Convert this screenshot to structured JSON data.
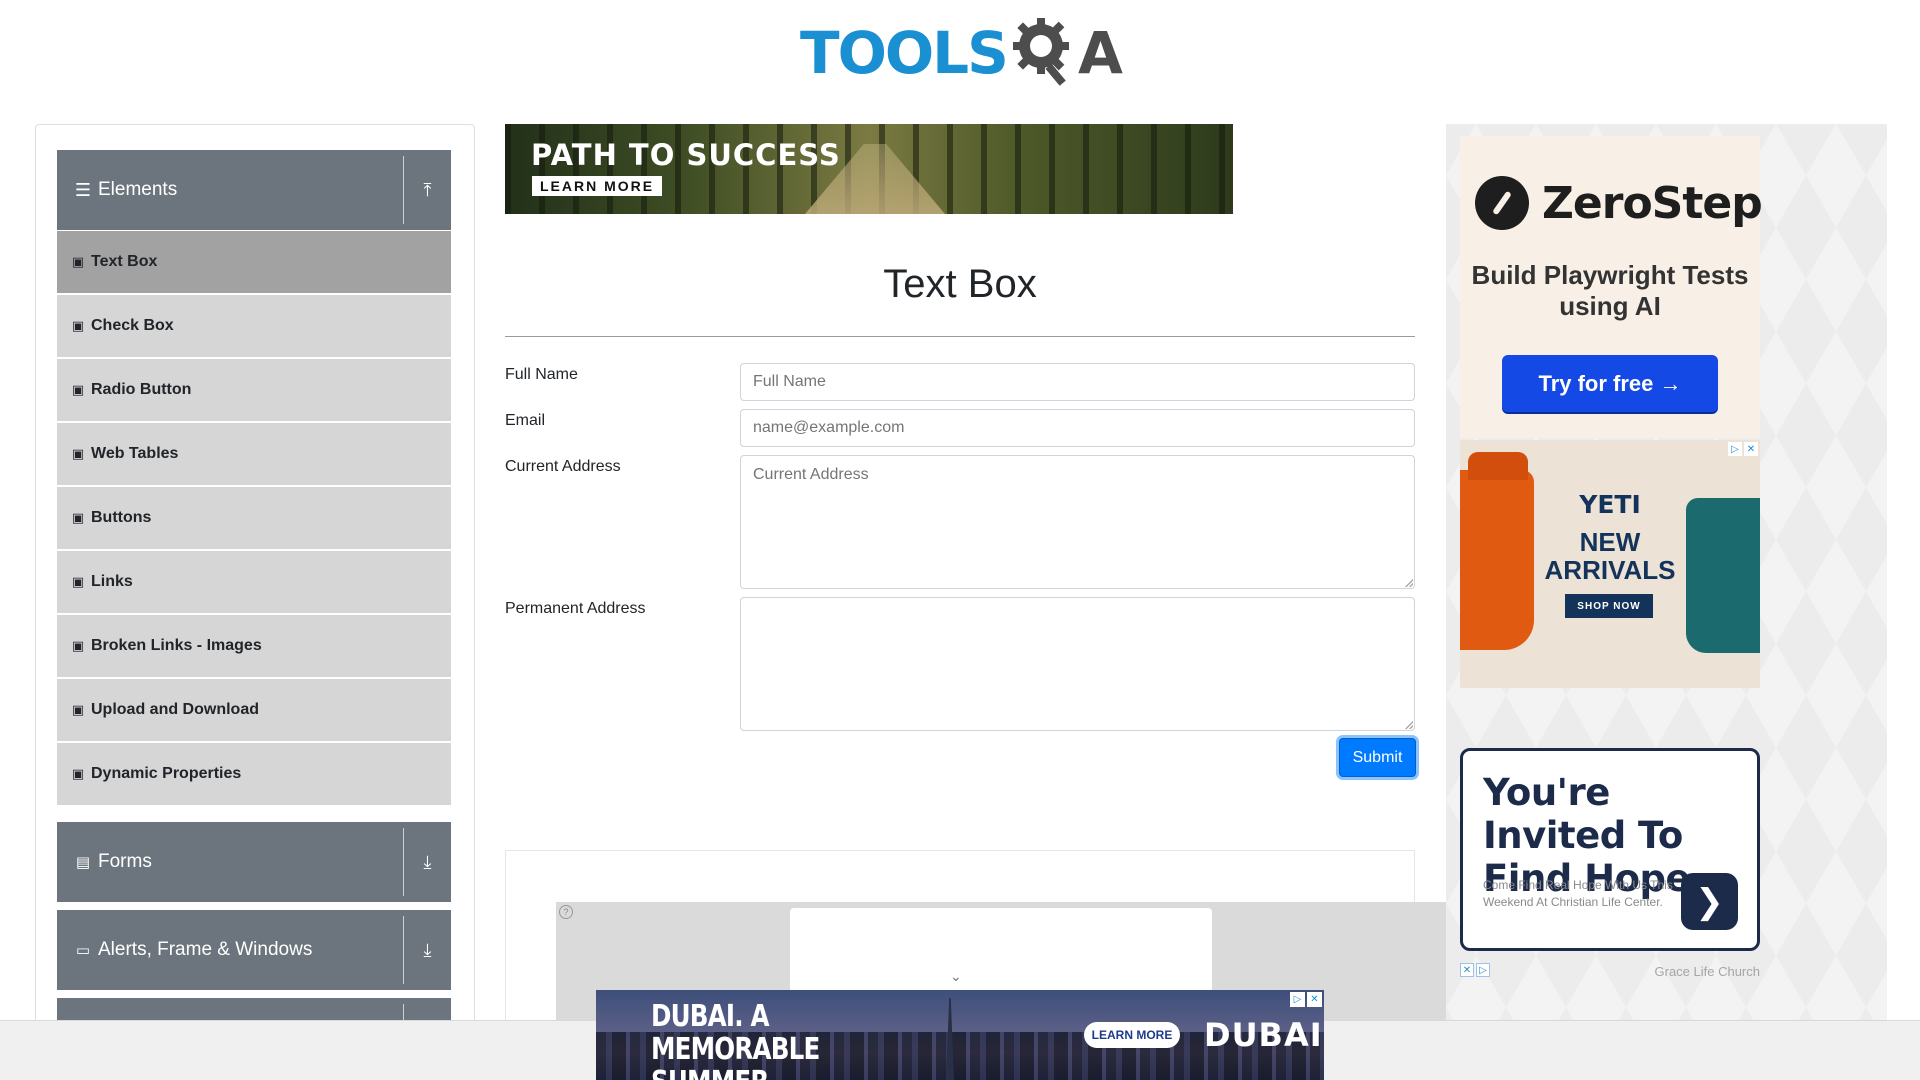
{
  "header": {
    "logo_text": "TOOLS",
    "logo_text_after": "A",
    "brand_color": "#1a8fd2"
  },
  "sidebar": {
    "groups": [
      {
        "title": "Elements",
        "icon": "hamburger-icon",
        "arrow": "collapse-up-icon",
        "expanded": true
      },
      {
        "title": "Forms",
        "icon": "file-icon",
        "arrow": "expand-down-icon",
        "expanded": false
      },
      {
        "title": "Alerts, Frame & Windows",
        "icon": "window-icon",
        "arrow": "expand-down-icon",
        "expanded": false
      }
    ],
    "items": [
      {
        "label": "Text Box",
        "active": true
      },
      {
        "label": "Check Box"
      },
      {
        "label": "Radio Button"
      },
      {
        "label": "Web Tables"
      },
      {
        "label": "Buttons"
      },
      {
        "label": "Links"
      },
      {
        "label": "Broken Links - Images"
      },
      {
        "label": "Upload and Download"
      },
      {
        "label": "Dynamic Properties"
      }
    ]
  },
  "banner": {
    "title": "PATH TO SUCCESS",
    "button": "LEARN MORE"
  },
  "form": {
    "title": "Text Box",
    "full_name_label": "Full Name",
    "full_name_placeholder": "Full Name",
    "email_label": "Email",
    "email_placeholder": "name@example.com",
    "current_address_label": "Current Address",
    "current_address_placeholder": "Current Address",
    "permanent_address_label": "Permanent Address",
    "permanent_address_placeholder": "",
    "submit_label": "Submit"
  },
  "ads": {
    "zerostep": {
      "name": "ZeroStep",
      "subtitle": "Build Playwright Tests using AI",
      "button": "Try for free →"
    },
    "yeti": {
      "brand": "YETI",
      "headline": "NEW ARRIVALS",
      "button": "SHOP NOW"
    },
    "hope": {
      "headline": "You're Invited To Find Hope",
      "body": "Come Find Real Hope With Us This Weekend At Christian Life Center.",
      "source": "Grace Life Church"
    },
    "dubai": {
      "headline": "DUBAI. A MEMORABLE SUMMER VACATION",
      "button": "LEARN MORE",
      "logo": "DUBAI"
    }
  },
  "colors": {
    "sidebar_header": "#6c757d",
    "menu_item": "#d6d6d6",
    "menu_item_active": "#a2a2a2",
    "submit": "#007bff"
  }
}
